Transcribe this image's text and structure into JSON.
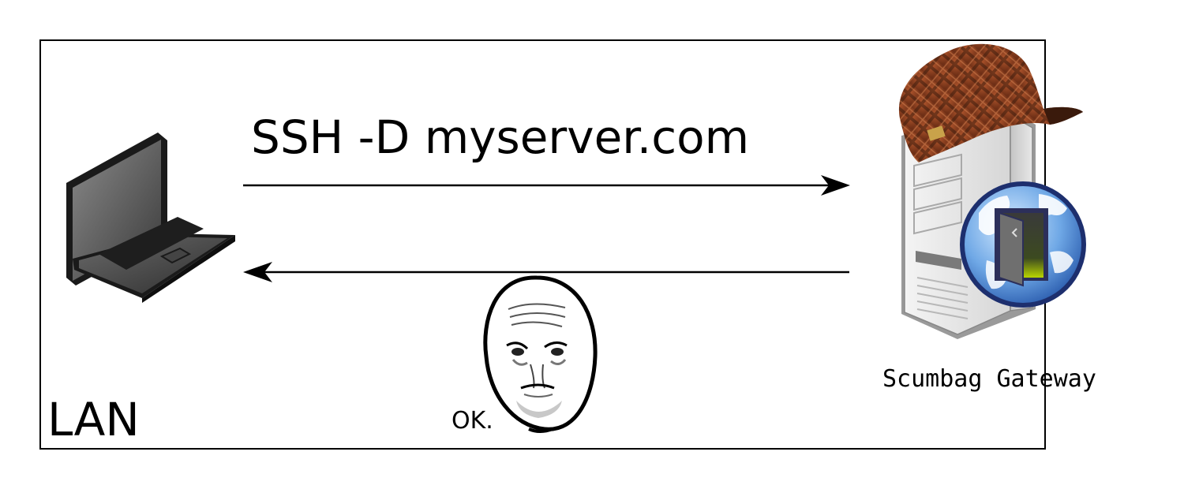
{
  "diagram": {
    "command_label": "SSH -D myserver.com",
    "lan_label": "LAN",
    "gateway_label": "Scumbag Gateway",
    "reply_label": "OK."
  },
  "icons": {
    "client": "laptop-icon",
    "gateway": "server-tower-icon",
    "gateway_badge": "globe-door-icon",
    "gateway_hat": "scumbag-hat-icon",
    "reaction": "okay-face-icon"
  }
}
